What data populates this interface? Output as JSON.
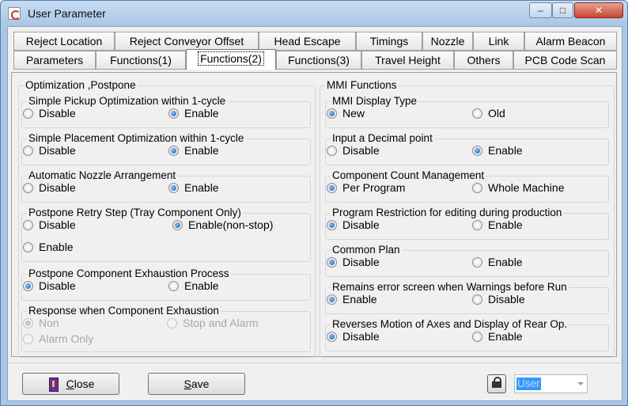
{
  "window": {
    "title": "User Parameter",
    "min_symbol": "‒",
    "max_symbol": "□",
    "close_symbol": "✕"
  },
  "tabs": {
    "row1": [
      "Reject Location",
      "Reject Conveyor Offset",
      "Head Escape",
      "Timings",
      "Nozzle",
      "Link",
      "Alarm Beacon"
    ],
    "row2": [
      "Parameters",
      "Functions(1)",
      "Functions(2)",
      "Functions(3)",
      "Travel Height",
      "Others",
      "PCB Code Scan"
    ],
    "active": "Functions(2)"
  },
  "optimization": {
    "title": "Optimization ,Postpone",
    "groups": [
      {
        "title": "Simple Pickup Optimization within 1-cycle",
        "options": [
          {
            "label": "Disable",
            "selected": false
          },
          {
            "label": "Enable",
            "selected": true
          }
        ]
      },
      {
        "title": "Simple Placement Optimization within 1-cycle",
        "options": [
          {
            "label": "Disable",
            "selected": false
          },
          {
            "label": "Enable",
            "selected": true
          }
        ]
      },
      {
        "title": "Automatic Nozzle Arrangement",
        "options": [
          {
            "label": "Disable",
            "selected": false
          },
          {
            "label": "Enable",
            "selected": true
          }
        ]
      },
      {
        "title": "Postpone Retry Step (Tray Component Only)",
        "options": [
          {
            "label": "Disable",
            "selected": false
          },
          {
            "label": "Enable(non-stop)",
            "selected": true
          },
          {
            "label": "Enable",
            "selected": false
          }
        ]
      },
      {
        "title": "Postpone Component Exhaustion Process",
        "options": [
          {
            "label": "Disable",
            "selected": true
          },
          {
            "label": "Enable",
            "selected": false
          }
        ]
      },
      {
        "title": "Response when Component Exhaustion",
        "disabled": true,
        "options": [
          {
            "label": "Non",
            "selected": true
          },
          {
            "label": "Stop and Alarm",
            "selected": false
          },
          {
            "label": "Alarm Only",
            "selected": false
          }
        ]
      }
    ]
  },
  "mmi": {
    "title": "MMI Functions",
    "groups": [
      {
        "title": "MMI Display Type",
        "options": [
          {
            "label": "New",
            "selected": true
          },
          {
            "label": "Old",
            "selected": false
          }
        ]
      },
      {
        "title": "Input a Decimal point",
        "options": [
          {
            "label": "Disable",
            "selected": false
          },
          {
            "label": "Enable",
            "selected": true
          }
        ]
      },
      {
        "title": "Component Count Management",
        "options": [
          {
            "label": "Per Program",
            "selected": true
          },
          {
            "label": "Whole Machine",
            "selected": false
          }
        ]
      },
      {
        "title": "Program Restriction for editing during production",
        "options": [
          {
            "label": "Disable",
            "selected": true
          },
          {
            "label": "Enable",
            "selected": false
          }
        ]
      },
      {
        "title": "Common Plan",
        "options": [
          {
            "label": "Disable",
            "selected": true
          },
          {
            "label": "Enable",
            "selected": false
          }
        ]
      },
      {
        "title": "Remains error screen when Warnings before Run",
        "options": [
          {
            "label": "Enable",
            "selected": true
          },
          {
            "label": "Disable",
            "selected": false
          }
        ]
      },
      {
        "title": "Reverses Motion of Axes and Display of Rear Op.",
        "options": [
          {
            "label": "Disable",
            "selected": true
          },
          {
            "label": "Enable",
            "selected": false
          }
        ]
      }
    ]
  },
  "footer": {
    "close_label": "Close",
    "close_mnemonic": "C",
    "close_rest": "lose",
    "save_label": "Save",
    "save_mnemonic": "S",
    "save_rest": "ave",
    "user_select": {
      "value": "User"
    }
  },
  "colors": {
    "window_frame": "#a9c6e6",
    "face": "#f0f0f0",
    "radio_dot": "#1a5fb4",
    "selection": "#3399ff"
  }
}
